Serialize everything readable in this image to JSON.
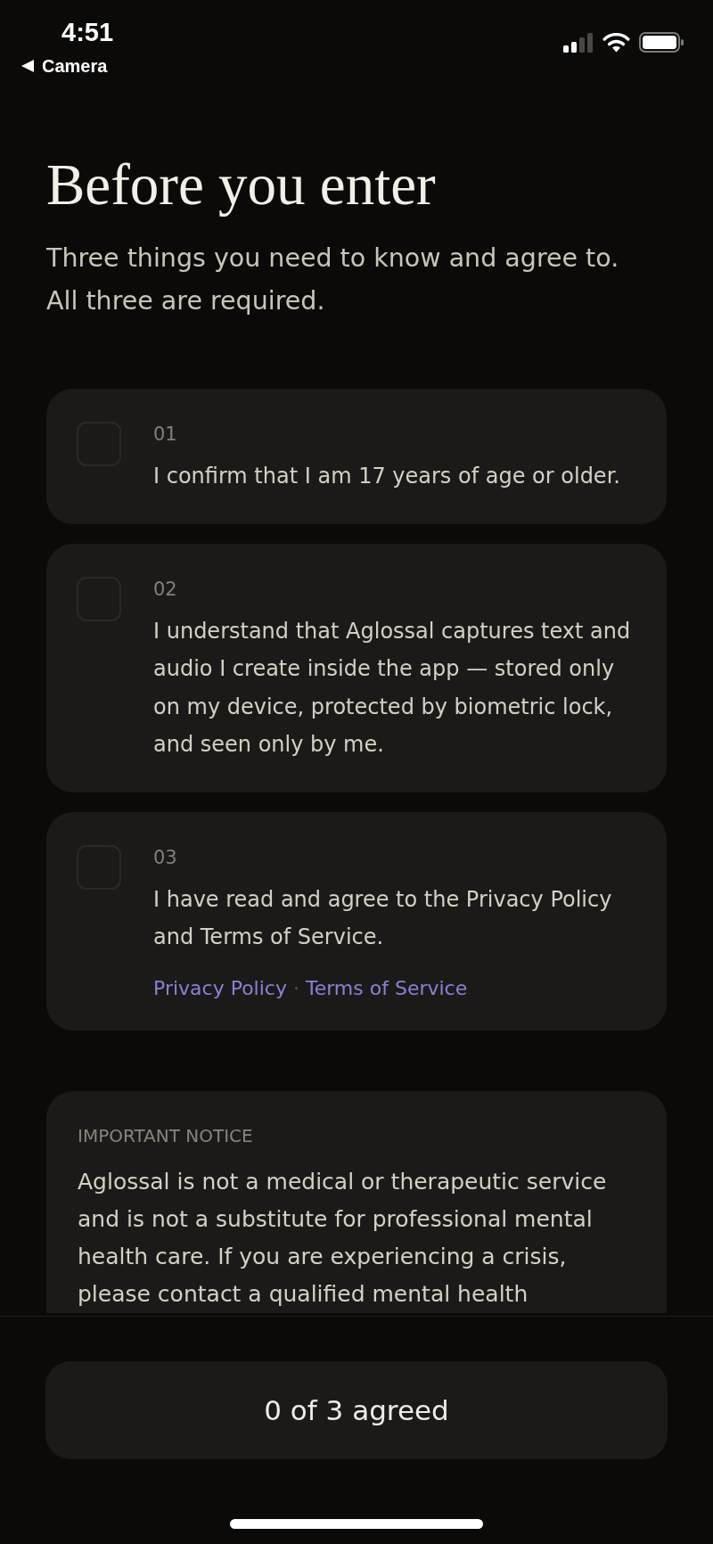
{
  "status_bar": {
    "time": "4:51",
    "back_label": "Camera"
  },
  "header": {
    "title": "Before you enter",
    "subtitle": [
      "Three things you need to know and agree to.",
      "All three are required."
    ]
  },
  "agreements": [
    {
      "number": "01",
      "text": "I confirm that I am 17 years of age or older.",
      "checked": false
    },
    {
      "number": "02",
      "text": "I understand that Aglossal captures text and audio I create inside the app — stored only on my device, protected by biometric lock, and seen only by me.",
      "checked": false
    },
    {
      "number": "03",
      "text": "I have read and agree to the Privacy Policy and Terms of Service.",
      "checked": false,
      "links": [
        "Privacy Policy",
        "Terms of Service"
      ],
      "link_separator": "·"
    }
  ],
  "notice": {
    "label": "IMPORTANT NOTICE",
    "text": "Aglossal is not a medical or therapeutic service and is not a substitute for professional mental health care. If you are experiencing a crisis, please contact a qualified mental health"
  },
  "footer_button": {
    "label": "0 of 3 agreed"
  }
}
